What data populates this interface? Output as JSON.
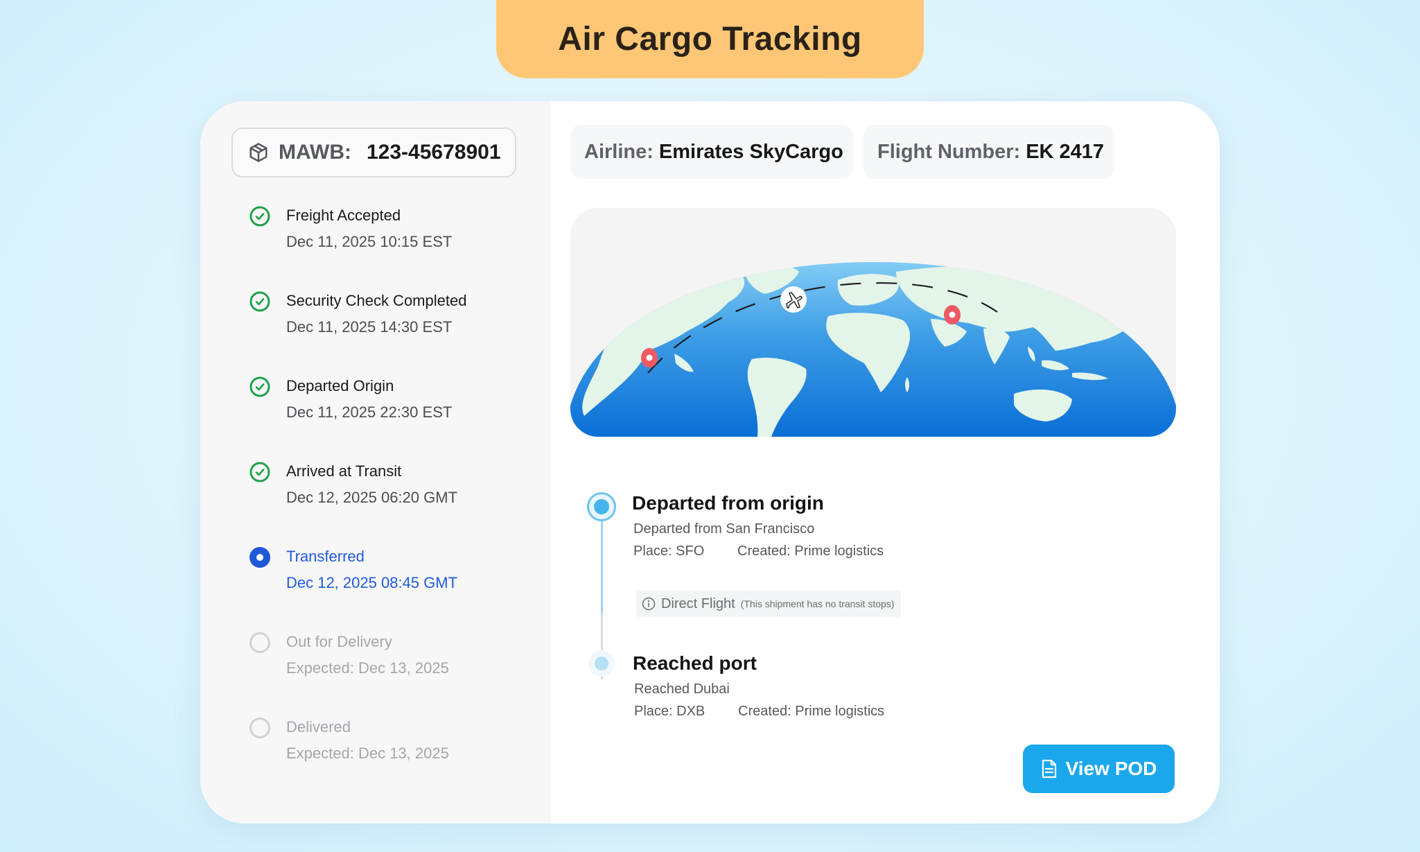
{
  "header": {
    "title": "Air Cargo Tracking"
  },
  "mawb": {
    "label": "MAWB:",
    "value": "123-45678901"
  },
  "steps": [
    {
      "name": "Freight Accepted",
      "time": "Dec 11, 2025 10:15 EST",
      "status": "done"
    },
    {
      "name": "Security Check Completed",
      "time": "Dec 11, 2025 14:30 EST",
      "status": "done"
    },
    {
      "name": "Departed Origin",
      "time": "Dec 11, 2025 22:30 EST",
      "status": "done"
    },
    {
      "name": "Arrived at Transit",
      "time": "Dec 12, 2025 06:20 GMT",
      "status": "done"
    },
    {
      "name": "Transferred",
      "time": "Dec 12, 2025 08:45 GMT",
      "status": "current"
    },
    {
      "name": "Out for Delivery",
      "time": "Expected: Dec 13, 2025",
      "status": "pending"
    },
    {
      "name": "Delivered",
      "time": "Expected: Dec 13, 2025",
      "status": "pending"
    }
  ],
  "flight_info": {
    "airline_label": "Airline:",
    "airline": "Emirates SkyCargo",
    "flight_label": "Flight Number:",
    "flight": "EK 2417"
  },
  "events": [
    {
      "title": "Departed from origin",
      "sub": "Departed from San Francisco",
      "place": "Place: SFO",
      "created": "Created: Prime logistics"
    },
    {
      "title": "Reached port",
      "sub": "Reached Dubai",
      "place": "Place: DXB",
      "created": "Created: Prime logistics"
    }
  ],
  "direct_flight": {
    "label": "Direct Flight",
    "note": "(This shipment has no transit stops)"
  },
  "actions": {
    "view_pod": "View POD"
  },
  "colors": {
    "accent": "#1ba7ec",
    "success": "#1fa04a",
    "current": "#1e5ad8",
    "title_bg": "#ffc775"
  },
  "icons": {
    "mawb": "package-icon",
    "done": "check-circle-icon",
    "current": "radio-dot-icon",
    "pending": "empty-circle-icon",
    "pod": "document-icon",
    "plane": "airplane-icon",
    "pin": "location-pin-icon",
    "info": "info-icon"
  }
}
